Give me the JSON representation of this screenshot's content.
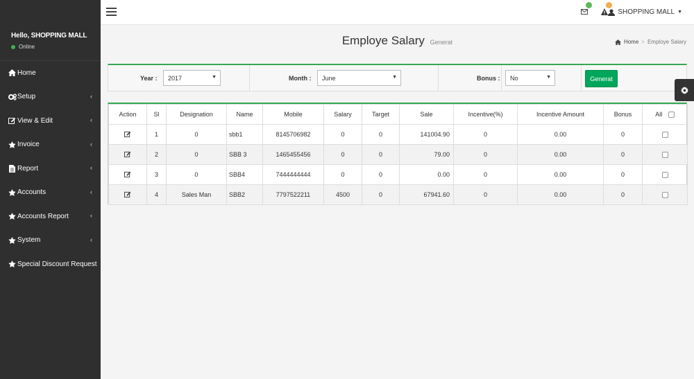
{
  "sidebar": {
    "greeting": "Hello, SHOPPING MALL",
    "status": "Online",
    "items": [
      {
        "label": "Home",
        "icon": "home-icon",
        "has_children": false
      },
      {
        "label": "Setup",
        "icon": "cogs-icon",
        "has_children": true
      },
      {
        "label": "View & Edit",
        "icon": "edit-icon",
        "has_children": true
      },
      {
        "label": "Invoice",
        "icon": "star-icon",
        "has_children": true
      },
      {
        "label": "Report",
        "icon": "file-icon",
        "has_children": true
      },
      {
        "label": "Accounts",
        "icon": "star-icon",
        "has_children": true
      },
      {
        "label": "Accounts Report",
        "icon": "star-icon",
        "has_children": true
      },
      {
        "label": "System",
        "icon": "star-icon",
        "has_children": true
      },
      {
        "label": "Special Discount Request",
        "icon": "star-icon",
        "has_children": false
      }
    ]
  },
  "navbar": {
    "user_name": "SHOPPING MALL",
    "colors": {
      "mail_badge": "#5cb85c",
      "alert_badge": "#f0ad4e"
    }
  },
  "header": {
    "title": "Employe Salary",
    "subtitle": "Generat",
    "breadcrumb": {
      "home": "Home",
      "current": "Employe Salary"
    }
  },
  "filters": {
    "year": {
      "label": "Year :",
      "value": "2017"
    },
    "month": {
      "label": "Month :",
      "value": "June"
    },
    "bonus": {
      "label": "Bonus :",
      "value": "No"
    },
    "generate_label": "Generat"
  },
  "table": {
    "columns": [
      "Action",
      "Sl",
      "Designation",
      "Name",
      "Mobile",
      "Salary",
      "Target",
      "Sale",
      "Incentive(%)",
      "Incentive Amount",
      "Bonus",
      "All"
    ],
    "rows": [
      {
        "sl": "1",
        "designation": "0",
        "name": "sbb1",
        "mobile": "8145706982",
        "salary": "0",
        "target": "0",
        "sale": "141004.90",
        "incentive_pct": "0",
        "incentive_amount": "0.00",
        "bonus": "0"
      },
      {
        "sl": "2",
        "designation": "0",
        "name": "SBB 3",
        "mobile": "1465455456",
        "salary": "0",
        "target": "0",
        "sale": "79.00",
        "incentive_pct": "0",
        "incentive_amount": "0.00",
        "bonus": "0"
      },
      {
        "sl": "3",
        "designation": "0",
        "name": "SBB4",
        "mobile": "7444444444",
        "salary": "0",
        "target": "0",
        "sale": "0.00",
        "incentive_pct": "0",
        "incentive_amount": "0.00",
        "bonus": "0"
      },
      {
        "sl": "4",
        "designation": "Sales Man",
        "name": "SBB2",
        "mobile": "7797522211",
        "salary": "4500",
        "target": "0",
        "sale": "67941.60",
        "incentive_pct": "0",
        "incentive_amount": "0.00",
        "bonus": "0"
      }
    ]
  },
  "colors": {
    "sidebar_bg": "#2f2f2f",
    "accent_green": "#00a65a",
    "box_border_top": "#34a853"
  }
}
